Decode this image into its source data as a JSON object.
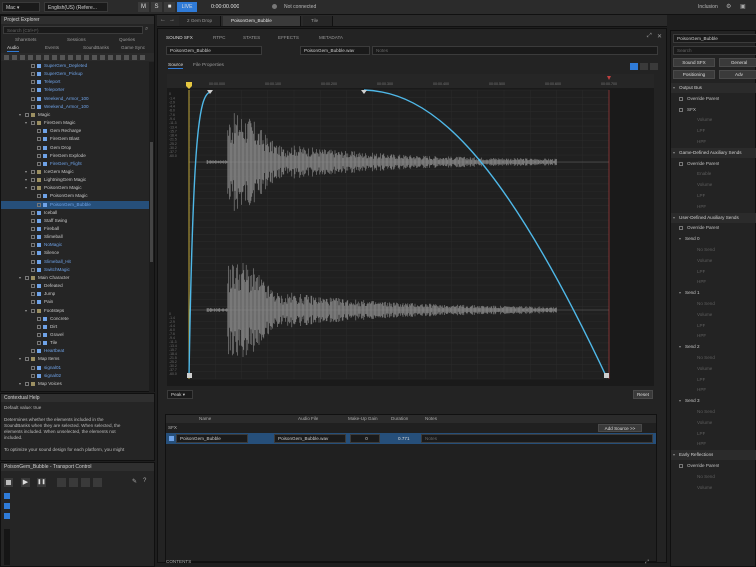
{
  "topbar": {
    "platform": "Mac",
    "language": "English(US) (Refere...",
    "time": "0:00:00.000",
    "live": "LIVE",
    "connection": "Not connected",
    "inclusion": "Inclusion"
  },
  "explorer": {
    "title": "Project Explorer",
    "search_placeholder": "Search (Ctrl+F)",
    "tabs_row1": [
      "ShareSets",
      "Sessions",
      "Queries"
    ],
    "tabs_row2": [
      "Audio",
      "Events",
      "SoundBanks",
      "Game Sync"
    ],
    "items": [
      {
        "label": "SuperGem_Depleted",
        "indent": 3,
        "color": "#6fa3e8",
        "type": "sound"
      },
      {
        "label": "SuperGem_Pickup",
        "indent": 3,
        "color": "#6fa3e8",
        "type": "sound"
      },
      {
        "label": "Teleport",
        "indent": 3,
        "color": "#6fa3e8",
        "type": "sound"
      },
      {
        "label": "Teleporter",
        "indent": 3,
        "color": "#6fa3e8",
        "type": "sound"
      },
      {
        "label": "Weekend_Armor_100",
        "indent": 3,
        "color": "#6fa3e8",
        "type": "sound"
      },
      {
        "label": "Weekend_Armor_100",
        "indent": 3,
        "color": "#6fa3e8",
        "type": "sound"
      },
      {
        "label": "Magic",
        "indent": 2,
        "color": "#c8c8c8",
        "type": "folder"
      },
      {
        "label": "FireGem Magic",
        "indent": 3,
        "color": "#c8c8c8",
        "type": "folder"
      },
      {
        "label": "Gem Recharge",
        "indent": 4,
        "color": "#c8c8c8",
        "type": "sound"
      },
      {
        "label": "FireGem Blast",
        "indent": 4,
        "color": "#c8c8c8",
        "type": "sound"
      },
      {
        "label": "Gem Drop",
        "indent": 4,
        "color": "#c8c8c8",
        "type": "sound"
      },
      {
        "label": "FireGem Explode",
        "indent": 4,
        "color": "#c8c8c8",
        "type": "sound"
      },
      {
        "label": "FireGem_Flight",
        "indent": 4,
        "color": "#6fa3e8",
        "type": "sound"
      },
      {
        "label": "IceGem Magic",
        "indent": 3,
        "color": "#c8c8c8",
        "type": "folder"
      },
      {
        "label": "LightningGem Magic",
        "indent": 3,
        "color": "#c8c8c8",
        "type": "folder"
      },
      {
        "label": "PoisonGem Magic",
        "indent": 3,
        "color": "#c8c8c8",
        "type": "folder"
      },
      {
        "label": "PoisonGem Magic",
        "indent": 4,
        "color": "#c8c8c8",
        "type": "sound"
      },
      {
        "label": "PoisonGem_Bubble",
        "indent": 4,
        "color": "#6fa3e8",
        "type": "sound",
        "selected": true
      },
      {
        "label": "Iceball",
        "indent": 3,
        "color": "#c8c8c8",
        "type": "sound"
      },
      {
        "label": "Staff Swing",
        "indent": 3,
        "color": "#c8c8c8",
        "type": "sound"
      },
      {
        "label": "Fireball",
        "indent": 3,
        "color": "#c8c8c8",
        "type": "sound"
      },
      {
        "label": "Slimeball",
        "indent": 3,
        "color": "#c8c8c8",
        "type": "sound"
      },
      {
        "label": "NoMagic",
        "indent": 3,
        "color": "#6fa3e8",
        "type": "sound"
      },
      {
        "label": "Silence",
        "indent": 3,
        "color": "#c8c8c8",
        "type": "sound"
      },
      {
        "label": "Slimeball_Hit",
        "indent": 3,
        "color": "#6fa3e8",
        "type": "sound"
      },
      {
        "label": "SwitchMagic",
        "indent": 3,
        "color": "#6fa3e8",
        "type": "sound"
      },
      {
        "label": "Main Character",
        "indent": 2,
        "color": "#c8c8c8",
        "type": "folder"
      },
      {
        "label": "Defeated",
        "indent": 3,
        "color": "#c8c8c8",
        "type": "sound"
      },
      {
        "label": "Jump",
        "indent": 3,
        "color": "#c8c8c8",
        "type": "sound"
      },
      {
        "label": "Pain",
        "indent": 3,
        "color": "#c8c8c8",
        "type": "sound"
      },
      {
        "label": "Footsteps",
        "indent": 3,
        "color": "#c8c8c8",
        "type": "folder"
      },
      {
        "label": "Concrete",
        "indent": 4,
        "color": "#c8c8c8",
        "type": "sound"
      },
      {
        "label": "Dirt",
        "indent": 4,
        "color": "#c8c8c8",
        "type": "sound"
      },
      {
        "label": "Gravel",
        "indent": 4,
        "color": "#c8c8c8",
        "type": "sound"
      },
      {
        "label": "Tile",
        "indent": 4,
        "color": "#c8c8c8",
        "type": "sound"
      },
      {
        "label": "Heartbeat",
        "indent": 3,
        "color": "#6fa3e8",
        "type": "sound"
      },
      {
        "label": "Map Items",
        "indent": 2,
        "color": "#c8c8c8",
        "type": "folder"
      },
      {
        "label": "signal01",
        "indent": 3,
        "color": "#6fa3e8",
        "type": "sound"
      },
      {
        "label": "signal02",
        "indent": 3,
        "color": "#6fa3e8",
        "type": "sound"
      },
      {
        "label": "Map Voices",
        "indent": 2,
        "color": "#c8c8c8",
        "type": "folder"
      }
    ]
  },
  "help": {
    "title": "Contextual Help",
    "lines": [
      "Default value: true",
      "",
      "Determines whether the elements included in the",
      "SoundBanks when they are selected. When selected, the",
      "elements included. When unselected, the elements not",
      "included.",
      "",
      "To optimize your sound design for each platform, you might"
    ]
  },
  "transport": {
    "title": "PoisonGem_Bubble - Transport Control"
  },
  "doc_tabs": [
    "2 Gem Drop",
    "PoisonGem_Bubble",
    "Tile"
  ],
  "editor": {
    "tabs": [
      "SOUND SFX",
      "RTPC",
      "STATES",
      "EFFECTS",
      "METADATA"
    ],
    "object_name": "PoisonGem_Bubble",
    "file_name": "PoisonGem_Bubble.wav",
    "notes_placeholder": "Notes",
    "source_tab": "Source",
    "file_props_tab": "File Properties",
    "peak_label": "Peak",
    "reset_label": "Reset",
    "time_ticks": [
      "00:00.000",
      "00:00.100",
      "00:00.200",
      "00:00.300",
      "00:00.400",
      "00:00.500",
      "00:00.600",
      "00:00.700"
    ],
    "db_labels": [
      "0",
      "-1.4",
      "-2.9",
      "-4.4",
      "-6.0",
      "-7.6",
      "-9.4",
      "-11.3",
      "-13.4",
      "-15.7",
      "-18.4",
      "-21.5",
      "-25.2",
      "-30.2",
      "-37.7",
      "-60.0"
    ]
  },
  "sources": {
    "headers": [
      "Name",
      "Audio File",
      "Make-Up Gain",
      "Duration",
      "Notes"
    ],
    "group_label": "SFX",
    "add_source": "Add Source >>",
    "row": {
      "name": "PoisonGem_Bubble",
      "file": "PoisonGem_Bubble.wav",
      "gain": "0",
      "duration": "0.771",
      "notes": "Notes"
    }
  },
  "contents_label": "CONTENTS",
  "right_panel": {
    "name": "PoisonGem_Bubble",
    "search_placeholder": "Search",
    "btn_sound_sfx": "Sound SFX",
    "btn_general": "General",
    "btn_positioning": "Positioning",
    "btn_advanced": "Adv",
    "rows": [
      {
        "label": "Output Bus",
        "kind": "head"
      },
      {
        "label": "Override Parent",
        "kind": "row"
      },
      {
        "label": "SFX",
        "kind": "row"
      },
      {
        "label": "Volume",
        "kind": "dim"
      },
      {
        "label": "LPF",
        "kind": "dim"
      },
      {
        "label": "HPF",
        "kind": "dim"
      },
      {
        "label": "Game-Defined Auxiliary Sends",
        "kind": "head"
      },
      {
        "label": "Override Parent",
        "kind": "row"
      },
      {
        "label": "Enable",
        "kind": "dim"
      },
      {
        "label": "Volume",
        "kind": "dim"
      },
      {
        "label": "LPF",
        "kind": "dim"
      },
      {
        "label": "HPF",
        "kind": "dim"
      },
      {
        "label": "User-Defined Auxiliary Sends",
        "kind": "head"
      },
      {
        "label": "Override Parent",
        "kind": "row"
      },
      {
        "label": "Send 0",
        "kind": "sub"
      },
      {
        "label": "No Send",
        "kind": "dim"
      },
      {
        "label": "Volume",
        "kind": "dim"
      },
      {
        "label": "LPF",
        "kind": "dim"
      },
      {
        "label": "HPF",
        "kind": "dim"
      },
      {
        "label": "Send 1",
        "kind": "sub"
      },
      {
        "label": "No Send",
        "kind": "dim"
      },
      {
        "label": "Volume",
        "kind": "dim"
      },
      {
        "label": "LPF",
        "kind": "dim"
      },
      {
        "label": "HPF",
        "kind": "dim"
      },
      {
        "label": "Send 2",
        "kind": "sub"
      },
      {
        "label": "No Send",
        "kind": "dim"
      },
      {
        "label": "Volume",
        "kind": "dim"
      },
      {
        "label": "LPF",
        "kind": "dim"
      },
      {
        "label": "HPF",
        "kind": "dim"
      },
      {
        "label": "Send 3",
        "kind": "sub"
      },
      {
        "label": "No Send",
        "kind": "dim"
      },
      {
        "label": "Volume",
        "kind": "dim"
      },
      {
        "label": "LPF",
        "kind": "dim"
      },
      {
        "label": "HPF",
        "kind": "dim"
      },
      {
        "label": "Early Reflections",
        "kind": "head"
      },
      {
        "label": "Override Parent",
        "kind": "row"
      },
      {
        "label": "No Send",
        "kind": "dim"
      },
      {
        "label": "Volume",
        "kind": "dim"
      }
    ]
  },
  "colors": {
    "accent": "#2f7bd8",
    "curve": "#4fb8e8",
    "selection": "#264f7a"
  }
}
